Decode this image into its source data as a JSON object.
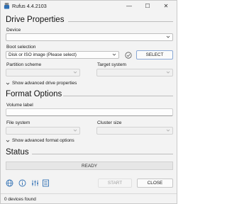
{
  "window": {
    "title": "Rufus 4.4.2103",
    "minimize_glyph": "—",
    "maximize_glyph": "☐",
    "close_glyph": "✕"
  },
  "drive_properties": {
    "heading": "Drive Properties",
    "device_label": "Device",
    "device_value": "",
    "boot_selection_label": "Boot selection",
    "boot_selection_value": "Disk or ISO image (Please select)",
    "select_button": "SELECT",
    "partition_scheme_label": "Partition scheme",
    "partition_scheme_value": "",
    "target_system_label": "Target system",
    "target_system_value": "",
    "advanced_toggle": "Show advanced drive properties"
  },
  "format_options": {
    "heading": "Format Options",
    "volume_label_label": "Volume label",
    "volume_label_value": "",
    "file_system_label": "File system",
    "file_system_value": "",
    "cluster_size_label": "Cluster size",
    "cluster_size_value": "",
    "advanced_toggle": "Show advanced format options"
  },
  "status": {
    "heading": "Status",
    "progress_text": "READY",
    "progress_fraction": 0
  },
  "toolbar": {
    "icons": [
      "globe-icon",
      "info-icon",
      "settings-icon",
      "log-icon"
    ],
    "start_button": "START",
    "close_button": "CLOSE"
  },
  "statusbar": {
    "text": "0 devices found"
  },
  "colors": {
    "window_bg": "#f3f3f3",
    "accent": "#0067c0",
    "check_icon": "#555555"
  }
}
